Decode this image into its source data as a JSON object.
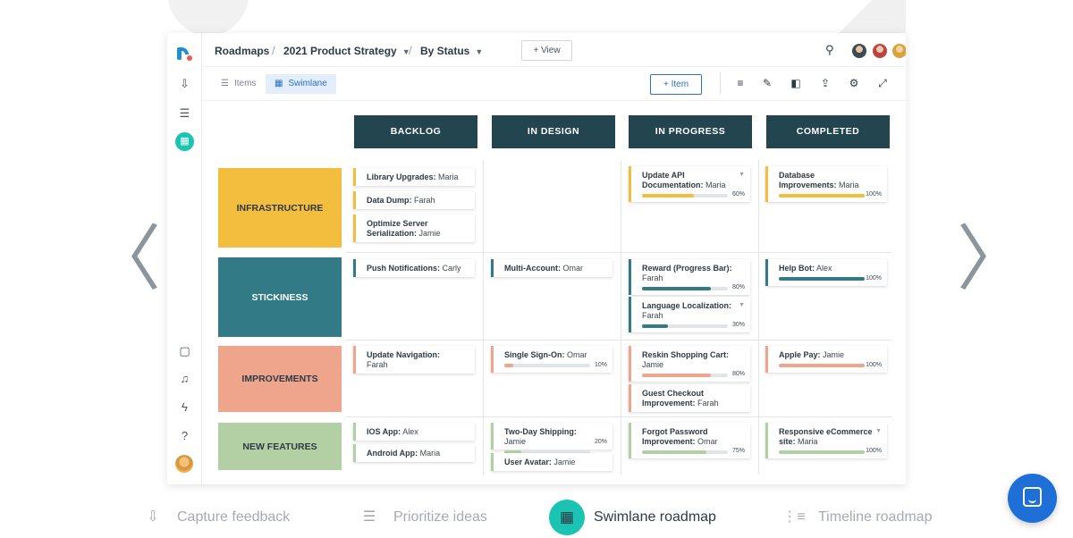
{
  "nav": {
    "prev_arrow": "〈",
    "next_arrow": "〉"
  },
  "app": {
    "breadcrumb": {
      "root": "Roadmaps",
      "roadmap": "2021 Product Strategy",
      "view": "By Status",
      "separator": "/",
      "add_view": "+ View"
    },
    "tabs": [
      {
        "label": "Items",
        "icon": "list-icon",
        "active": false
      },
      {
        "label": "Swimlane",
        "icon": "swimlane-icon",
        "active": true
      }
    ],
    "add_item": "+ Item",
    "columns": [
      "BACKLOG",
      "IN DESIGN",
      "IN PROGRESS",
      "COMPLETED"
    ],
    "lanes": [
      {
        "name": "INFRASTRUCTURE",
        "color": "#f3bd3e"
      },
      {
        "name": "STICKINESS",
        "color": "#327a85"
      },
      {
        "name": "IMPROVEMENTS",
        "color": "#eea58c"
      },
      {
        "name": "NEW FEATURES",
        "color": "#b3d0a5"
      }
    ],
    "cards": {
      "c1": {
        "title": "Library Upgrades:",
        "owner": "Maria"
      },
      "c2": {
        "title": "Data Dump:",
        "owner": "Farah"
      },
      "c3": {
        "title": "Optimize Server Serialization:",
        "owner": "Jamie"
      },
      "c4": {
        "title": "Update API Documentation:",
        "owner": "Maria",
        "progress": "60%",
        "caret": "▼"
      },
      "c5": {
        "title": "Database Improvements:",
        "owner": "Maria",
        "progress": "100%"
      },
      "c6": {
        "title": "Push Notifications:",
        "owner": "Carly"
      },
      "c7": {
        "title": "Multi-Account:",
        "owner": "Omar"
      },
      "c8": {
        "title": "Reward (Progress Bar):",
        "owner": "Farah",
        "progress": "80%"
      },
      "c9": {
        "title": "Language Localization:",
        "owner": "Farah",
        "progress": "30%",
        "caret": "▼"
      },
      "c10": {
        "title": "Help Bot:",
        "owner": "Alex",
        "progress": "100%"
      },
      "c11": {
        "title": "Update Navigation:",
        "owner": "Farah"
      },
      "c12": {
        "title": "Single Sign-On:",
        "owner": "Omar",
        "progress": "10%"
      },
      "c13": {
        "title": "Reskin Shopping Cart:",
        "owner": "Jamie",
        "progress": "80%"
      },
      "c14": {
        "title": "Guest Checkout Improvement:",
        "owner": "Farah"
      },
      "c15": {
        "title": "Apple Pay:",
        "owner": "Jamie",
        "progress": "100%"
      },
      "c16": {
        "title": "IOS App:",
        "owner": "Alex"
      },
      "c17": {
        "title": "Android App:",
        "owner": "Maria"
      },
      "c18": {
        "title": "Two-Day Shipping:",
        "owner": "Jamie",
        "progress": "20%"
      },
      "c19": {
        "title": "User Avatar:",
        "owner": "Jamie"
      },
      "c20": {
        "title": "Forgot Password Improvement:",
        "owner": "Omar",
        "progress": "75%"
      },
      "c21": {
        "title": "Responsive eCommerce site:",
        "owner": "Maria",
        "progress": "100%",
        "caret": "▼"
      }
    }
  },
  "bottom_nav": [
    {
      "label": "Capture feedback",
      "icon": "inbox-download-icon",
      "active": false
    },
    {
      "label": "Prioritize ideas",
      "icon": "prioritize-list-icon",
      "active": false
    },
    {
      "label": "Swimlane roadmap",
      "icon": "swimlane-board-icon",
      "active": true
    },
    {
      "label": "Timeline roadmap",
      "icon": "timeline-icon",
      "active": false
    }
  ],
  "colors": {
    "column_header": "#234550",
    "accent_teal": "#1bc3b3",
    "primary_blue": "#2a6fc9",
    "chat_blue": "#1f6fd9"
  }
}
